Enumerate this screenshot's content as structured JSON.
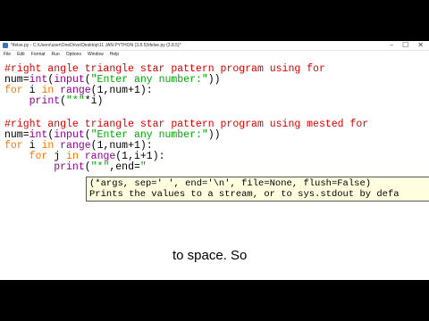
{
  "window": {
    "title": "*ifelse.py - C:\\Users\\user\\OneDrive\\Desktop\\11 JAN PYTHON (3.8.5)\\ifelse.py (3.8.5)*",
    "minimize_glyph": "–",
    "maximize_glyph": "☐",
    "close_glyph": "✕"
  },
  "menu": [
    "File",
    "Edit",
    "Format",
    "Run",
    "Options",
    "Window",
    "Help"
  ],
  "code": {
    "l1": "#right angle triangle star pattern program using for",
    "l2_a": "num=",
    "l2_b": "int",
    "l2_c": "(",
    "l2_d": "input",
    "l2_e": "(",
    "l2_f": "\"Enter any number:\"",
    "l2_g": "))",
    "l3_a": "for",
    "l3_b": " i ",
    "l3_c": "in",
    "l3_d": " ",
    "l3_e": "range",
    "l3_f": "(1,num+1):",
    "l4_a": "    ",
    "l4_b": "print",
    "l4_c": "(",
    "l4_d": "\"*\"",
    "l4_e": "*i)",
    "l5": "#right angle triangle star pattern program using mested for",
    "l6_a": "num=",
    "l6_b": "int",
    "l6_c": "(",
    "l6_d": "input",
    "l6_e": "(",
    "l6_f": "\"Enter any number:\"",
    "l6_g": "))",
    "l7_a": "for",
    "l7_b": " i ",
    "l7_c": "in",
    "l7_d": " ",
    "l7_e": "range",
    "l7_f": "(1,num+1):",
    "l8_a": "    ",
    "l8_b": "for",
    "l8_c": " j ",
    "l8_d": "in",
    "l8_e": " ",
    "l8_f": "range",
    "l8_g": "(1,i+1):",
    "l9_a": "        ",
    "l9_b": "print",
    "l9_c": "(",
    "l9_d": "\"*\"",
    "l9_e": ",end=",
    "l9_f": "\""
  },
  "calltip": {
    "line1": "(*args, sep=' ', end='\\n', file=None, flush=False)",
    "line2": "Prints the values to a stream, or to sys.stdout by defa"
  },
  "subtitle": "to space. So"
}
